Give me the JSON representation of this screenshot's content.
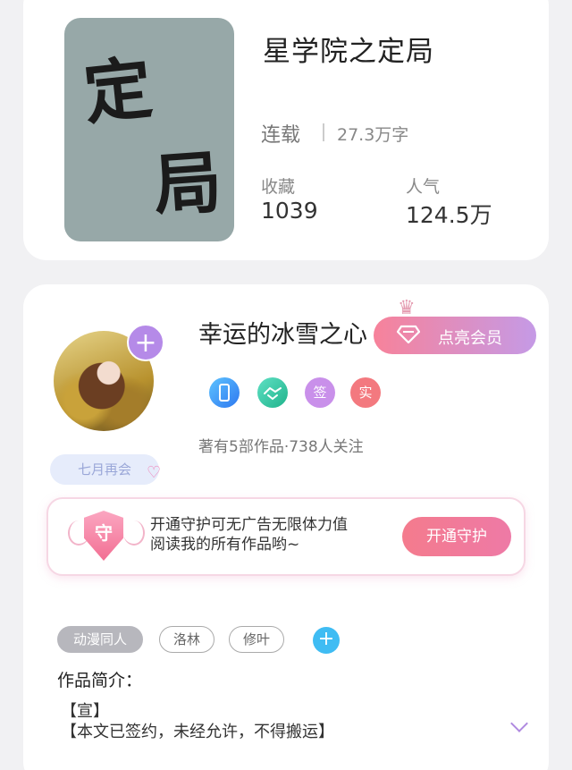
{
  "book": {
    "cover_text": [
      "定",
      "局"
    ],
    "title": "星学院之定局",
    "status": "连载",
    "word_count": "27.3万字",
    "stats": [
      {
        "label": "收藏",
        "value": "1039"
      },
      {
        "label": "人气",
        "value": "124.5万"
      }
    ]
  },
  "author": {
    "name": "幸运的冰雪之心",
    "add_follow_icon": "plus-icon",
    "vip_button": "点亮会员",
    "badges": [
      {
        "icon": "phone-badge-icon",
        "text": ""
      },
      {
        "icon": "handshake-badge-icon",
        "text": ""
      },
      {
        "icon": "sign-badge-icon",
        "text": "签"
      },
      {
        "icon": "verified-badge-icon",
        "text": "实"
      }
    ],
    "works_info": "著有5部作品·738人关注",
    "sticker": "七月再会"
  },
  "guard": {
    "shield_char": "守",
    "text_line1": "开通守护可无广告无限体力值",
    "text_line2": "阅读我的所有作品哟~",
    "button": "开通守护"
  },
  "tags": [
    "动漫同人",
    "洛林",
    "修叶"
  ],
  "intro": {
    "label": "作品简介：",
    "line1": "【宣】",
    "line2": "【本文已签约，未经允许，不得搬运】"
  },
  "colors": {
    "vip_gradient": [
      "#f7829a",
      "#c59ae6"
    ],
    "accent_purple": "#b58ae8",
    "tag_add": "#3fbcf3"
  }
}
